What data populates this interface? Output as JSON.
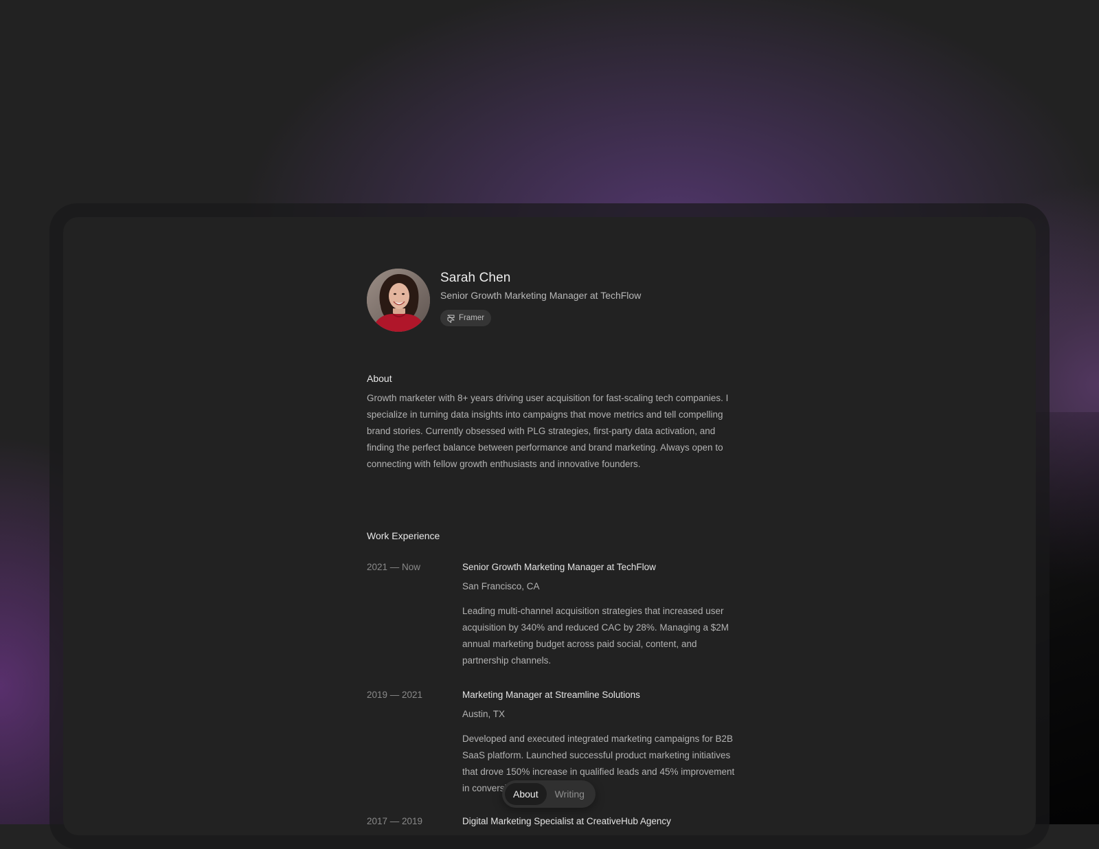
{
  "profile": {
    "name": "Sarah Chen",
    "role": "Senior Growth Marketing Manager at TechFlow",
    "badge": {
      "icon": "framer-icon",
      "label": "Framer"
    },
    "avatar_icon": "profile-photo"
  },
  "about": {
    "title": "About",
    "text": "Growth marketer with 8+ years driving user acquisition for fast-scaling tech companies. I specialize in turning data insights into campaigns that move metrics and tell compelling brand stories. Currently obsessed with PLG strategies, first-party data activation, and finding the perfect balance between performance and brand marketing. Always open to connecting with fellow growth enthusiasts and innovative founders."
  },
  "work": {
    "title": "Work Experience",
    "jobs": [
      {
        "date": "2021 — Now",
        "title": "Senior Growth Marketing Manager at TechFlow",
        "location": "San Francisco, CA",
        "description": "Leading multi-channel acquisition strategies that increased user acquisition by 340% and reduced CAC by 28%. Managing a $2M annual marketing budget across paid social, content, and partnership channels."
      },
      {
        "date": "2019 — 2021",
        "title": "Marketing Manager at Streamline Solutions",
        "location": "Austin, TX",
        "description": "Developed and executed integrated marketing campaigns for B2B SaaS platform. Launched successful product marketing initiatives that drove 150% increase in qualified leads and 45% improvement in conversion rates."
      },
      {
        "date": "2017 — 2019",
        "title": "Digital Marketing Specialist at CreativeHub Agency",
        "location": "",
        "description": ""
      }
    ]
  },
  "tabbar": {
    "tabs": [
      {
        "label": "About",
        "active": true
      },
      {
        "label": "Writing",
        "active": false
      }
    ]
  },
  "colors": {
    "background": "#232323",
    "card": "#222222",
    "accent_glow": "#7646a5",
    "text_primary": "#ececec",
    "text_secondary": "#b3b3b3",
    "text_muted": "#8a8a8a"
  }
}
